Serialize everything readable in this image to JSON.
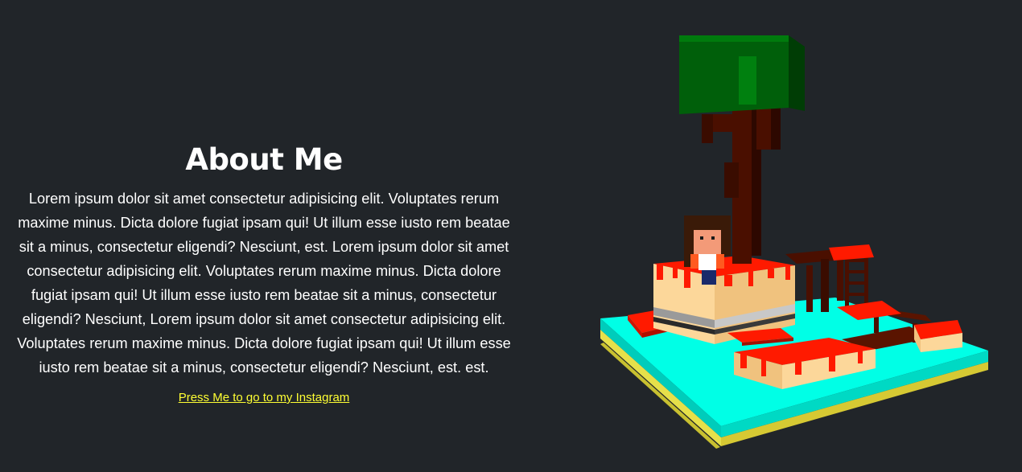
{
  "about": {
    "title": "About Me",
    "paragraph": "Lorem ipsum dolor sit amet consectetur adipisicing elit. Voluptates rerum maxime minus. Dicta dolore fugiat ipsam qui! Ut illum esse iusto rem beatae sit a minus, consectetur eligendi? Nesciunt, est. Lorem ipsum dolor sit amet consectetur adipisicing elit. Voluptates rerum maxime minus. Dicta dolore fugiat ipsam qui! Ut illum esse iusto rem beatae sit a minus, consectetur eligendi? Nesciunt, Lorem ipsum dolor sit amet consectetur adipisicing elit. Voluptates rerum maxime minus. Dicta dolore fugiat ipsam qui! Ut illum esse iusto rem beatae sit a minus, consectetur eligendi? Nesciunt, est. est.",
    "link_label": "Press Me to go to my Instagram"
  },
  "colors": {
    "background": "#212529",
    "text": "#ffffff",
    "link": "#ffff33",
    "water": "#00ffe6",
    "sand": "#fcd79a",
    "lava": "#ff1a00",
    "trunk": "#4a0f00",
    "leaves": "#005f0a"
  },
  "scene": {
    "icon": "voxel-island-scene"
  }
}
